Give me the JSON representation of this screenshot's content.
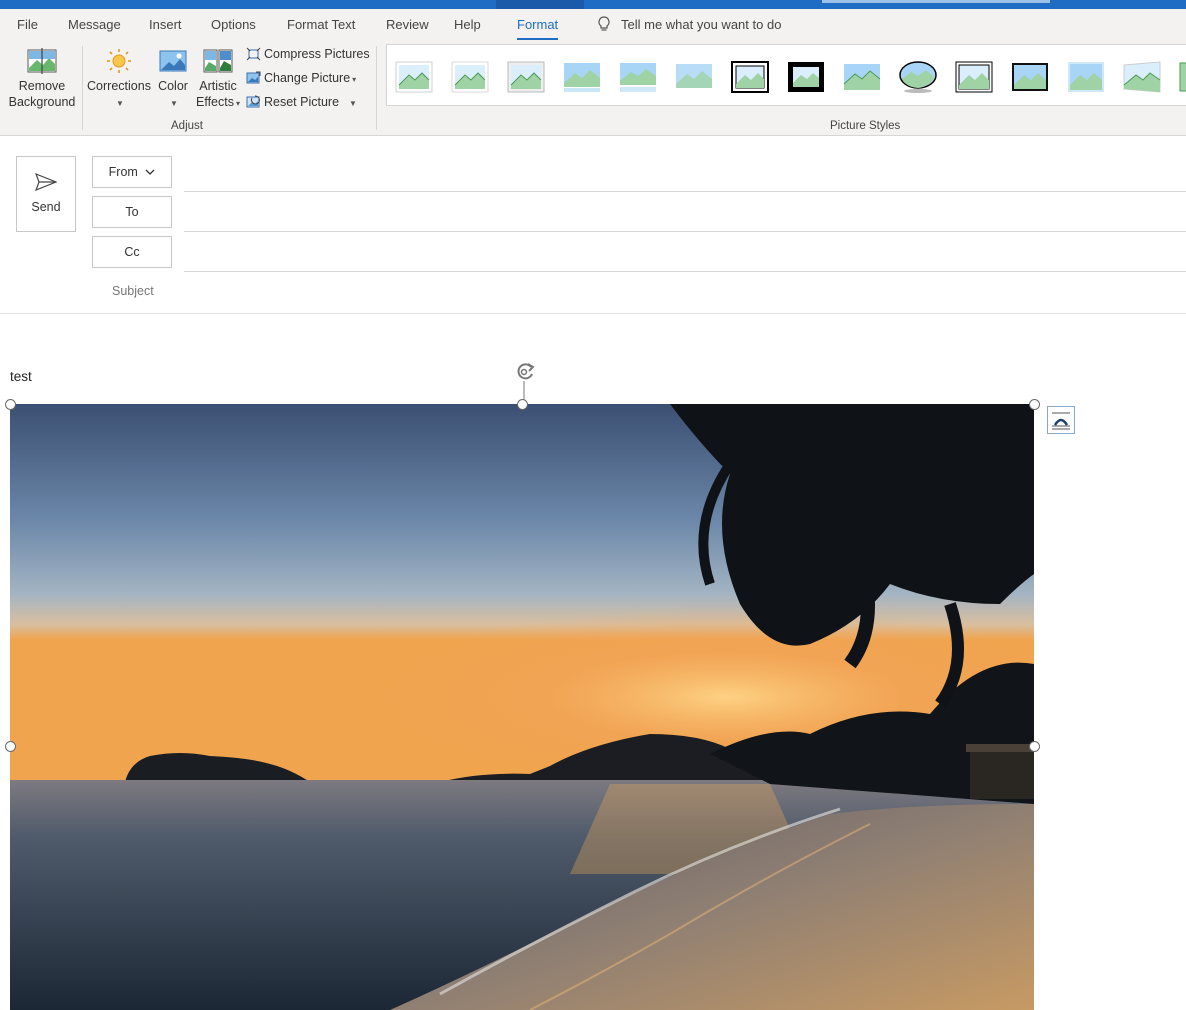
{
  "tabs": {
    "file": "File",
    "message": "Message",
    "insert": "Insert",
    "options": "Options",
    "format_text": "Format Text",
    "review": "Review",
    "help": "Help",
    "format": "Format"
  },
  "tell_me": "Tell me what you want to do",
  "ribbon": {
    "remove_bg_line1": "Remove",
    "remove_bg_line2": "Background",
    "corrections": "Corrections",
    "color": "Color",
    "artistic_line1": "Artistic",
    "artistic_line2": "Effects",
    "compress": "Compress Pictures",
    "change": "Change Picture",
    "reset": "Reset Picture",
    "group_adjust": "Adjust",
    "group_styles": "Picture Styles"
  },
  "compose": {
    "send": "Send",
    "from": "From",
    "to": "To",
    "cc": "Cc",
    "subject": "Subject"
  },
  "body": {
    "text": "test"
  },
  "colors": {
    "accent": "#1f6cc4",
    "ribbon_bg": "#f3f2f1"
  }
}
